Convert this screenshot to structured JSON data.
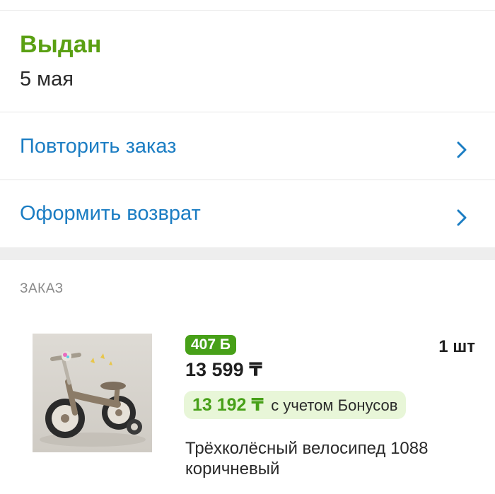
{
  "status": {
    "title": "Выдан",
    "date": "5 мая",
    "title_color": "#5aa013"
  },
  "actions": [
    {
      "label": "Повторить заказ",
      "icon": "chevron-right-icon"
    },
    {
      "label": "Оформить возврат",
      "icon": "chevron-right-icon"
    }
  ],
  "order": {
    "section_label": "ЗАКАЗ",
    "item": {
      "bonus_badge": "407 Б",
      "price": "13 599 ₸",
      "quantity": "1 шт",
      "bonus_price_value": "13 192 ₸",
      "bonus_price_text": "с учетом Бонусов",
      "name": "Трёхколёсный велосипед 1088 коричневый",
      "image": "balance-bike-product-photo"
    }
  },
  "colors": {
    "link": "#1b7dc3",
    "accent_green": "#47a018",
    "pill_bg": "#e8f6d8"
  }
}
